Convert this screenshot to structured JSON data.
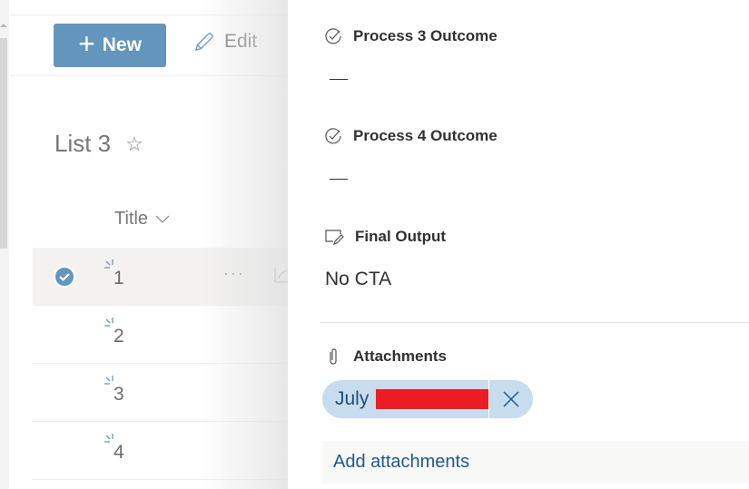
{
  "toolbar": {
    "new_label": "New",
    "edit_label": "Edit"
  },
  "list": {
    "title": "List 3",
    "column_header": "Title",
    "rows": [
      {
        "title": "1",
        "selected": true
      },
      {
        "title": "2",
        "selected": false
      },
      {
        "title": "3",
        "selected": false
      },
      {
        "title": "4",
        "selected": false
      }
    ]
  },
  "panel": {
    "fields": [
      {
        "label": "Process 3 Outcome",
        "icon": "choice-check-icon",
        "value": "—"
      },
      {
        "label": "Process 4 Outcome",
        "icon": "choice-check-icon",
        "value": "—"
      },
      {
        "label": "Final Output",
        "icon": "text-edit-icon",
        "value": "No CTA"
      }
    ],
    "attachments": {
      "label": "Attachments",
      "icon": "paperclip-icon",
      "files": [
        {
          "name": "July",
          "redacted": true
        }
      ],
      "add_label": "Add attachments"
    }
  },
  "colors": {
    "accent": "#6495bd",
    "chip_bg": "#c7dcec",
    "link": "#1e5a8e",
    "redaction": "#ed1c24"
  }
}
